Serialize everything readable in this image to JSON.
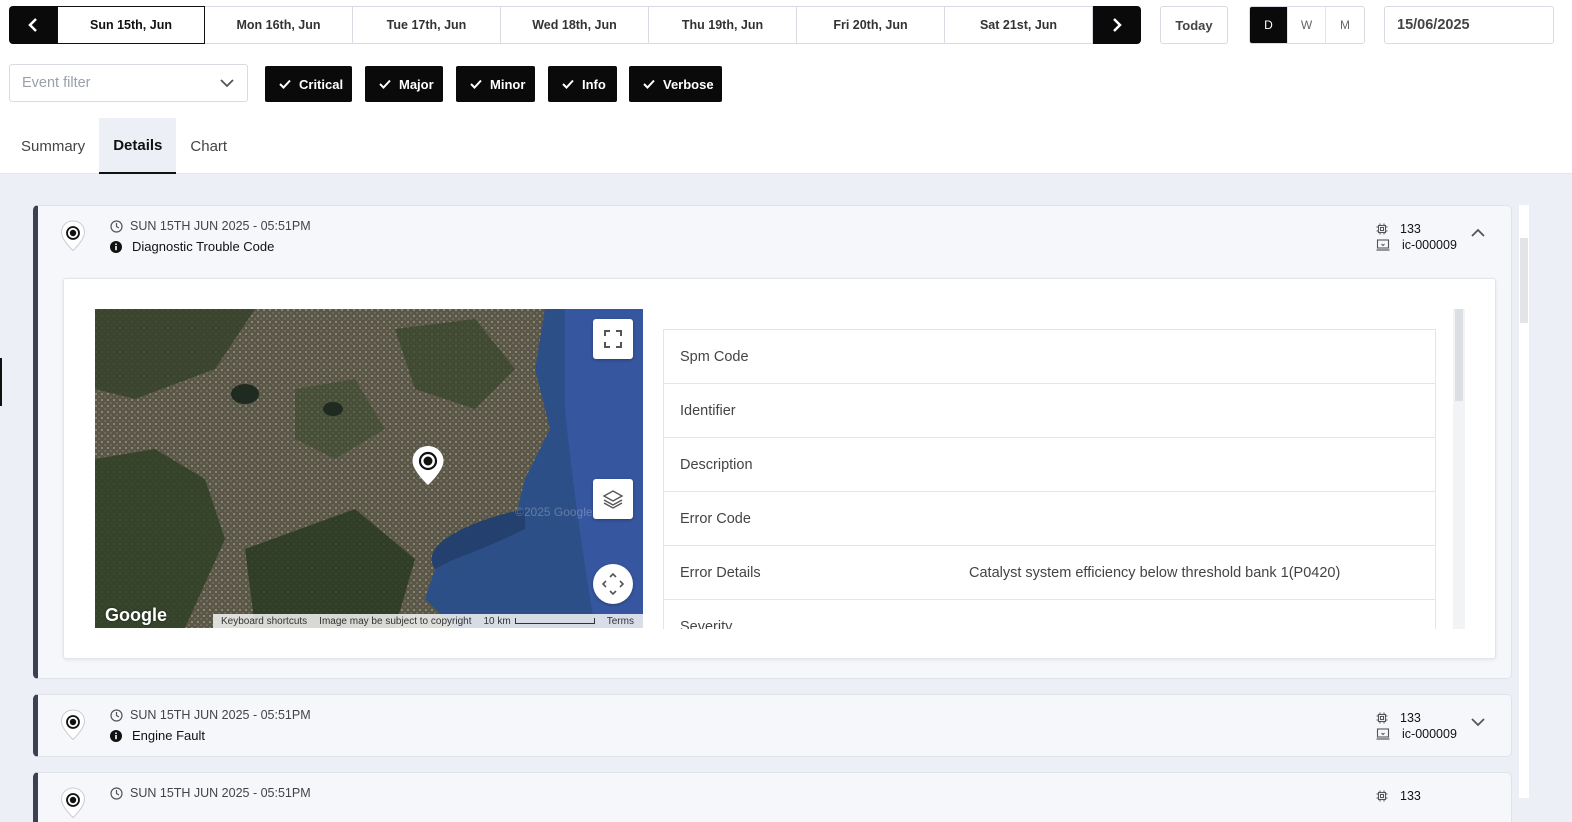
{
  "date_nav": {
    "days": [
      "Sun 15th, Jun",
      "Mon 16th, Jun",
      "Tue 17th, Jun",
      "Wed 18th, Jun",
      "Thu 19th, Jun",
      "Fri 20th, Jun",
      "Sat 21st, Jun"
    ],
    "active_day": "Sun 15th, Jun",
    "today_label": "Today",
    "periods": [
      "D",
      "W",
      "M"
    ],
    "selected_period": "D",
    "date_value": "15/06/2025"
  },
  "filter": {
    "placeholder": "Event filter",
    "severities": [
      "Critical",
      "Major",
      "Minor",
      "Info",
      "Verbose"
    ]
  },
  "tabs": [
    "Summary",
    "Details",
    "Chart"
  ],
  "active_tab": "Details",
  "events": [
    {
      "time": "SUN 15TH JUN 2025 - 05:51PM",
      "title": "Diagnostic Trouble Code",
      "count": "133",
      "device": "ic-000009",
      "expanded": true
    },
    {
      "time": "SUN 15TH JUN 2025 - 05:51PM",
      "title": "Engine Fault",
      "count": "133",
      "device": "ic-000009",
      "expanded": false
    },
    {
      "time": "SUN 15TH JUN 2025 - 05:51PM",
      "title": "",
      "count": "133",
      "device": "",
      "expanded": false
    }
  ],
  "detail": {
    "map": {
      "logo": "Google",
      "watermark": "©2025 Google",
      "footer": [
        "Keyboard shortcuts",
        "Image may be subject to copyright",
        "10 km",
        "Terms"
      ]
    },
    "properties": [
      {
        "key": "Spm Code",
        "value": ""
      },
      {
        "key": "Identifier",
        "value": ""
      },
      {
        "key": "Description",
        "value": ""
      },
      {
        "key": "Error Code",
        "value": ""
      },
      {
        "key": "Error Details",
        "value": "Catalyst system efficiency below threshold bank 1(P0420)"
      },
      {
        "key": "Severity",
        "value": ""
      }
    ]
  },
  "icons": [
    "chevron-left-icon",
    "chevron-right-icon",
    "chevron-down-icon",
    "check-icon",
    "location-pin-icon",
    "clock-icon",
    "info-icon",
    "chip-icon",
    "device-icon",
    "chevron-up-icon",
    "fullscreen-icon",
    "layers-icon",
    "move-arrows-icon"
  ],
  "colors": {
    "primary": "#0a0a0a",
    "background": "#eceff5",
    "card": "#f5f7fa",
    "card_accent": "#3a4150"
  }
}
